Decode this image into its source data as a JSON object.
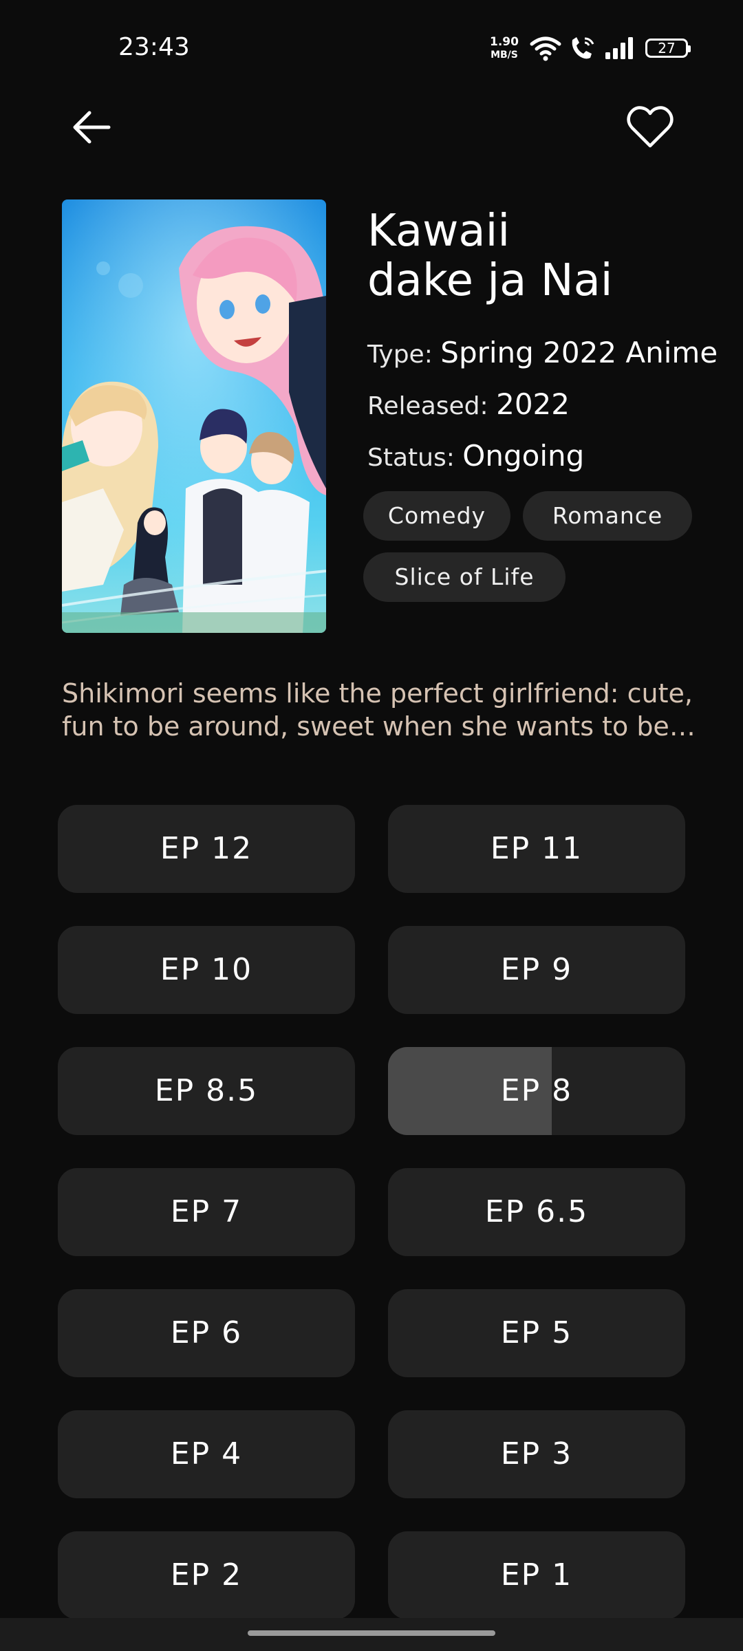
{
  "status_bar": {
    "time": "23:43",
    "net_speed_value": "1.90",
    "net_speed_unit": "MB/S",
    "battery": "27",
    "icons": [
      "wifi-icon",
      "wifi-call-icon",
      "signal-icon",
      "battery-icon"
    ]
  },
  "top_bar": {
    "back_icon": "arrow-left-icon",
    "favorite_icon": "heart-outline-icon"
  },
  "anime": {
    "title_line1": "Kawaii",
    "title_line2": "dake ja Nai",
    "type_label": "Type:",
    "type_value": "Spring 2022 Anime",
    "released_label": "Released:",
    "released_value": "2022",
    "status_label": "Status:",
    "status_value": "Ongoing",
    "genres": [
      "Comedy",
      "Romance",
      "Slice of Life"
    ],
    "description": "Shikimori seems like the perfect girlfriend: cute, fun to be around, sweet when she wants to be…"
  },
  "episodes": [
    {
      "label": "EP 12"
    },
    {
      "label": "EP 11"
    },
    {
      "label": "EP 10"
    },
    {
      "label": "EP 9"
    },
    {
      "label": "EP 8.5"
    },
    {
      "label": "EP 8",
      "progress": 0.55
    },
    {
      "label": "EP 7"
    },
    {
      "label": "EP 6.5"
    },
    {
      "label": "EP 6"
    },
    {
      "label": "EP 5"
    },
    {
      "label": "EP 4"
    },
    {
      "label": "EP 3"
    },
    {
      "label": "EP 2"
    },
    {
      "label": "EP 1"
    }
  ],
  "colors": {
    "background": "#0c0c0c",
    "card": "#222222",
    "progress": "#4a4a4a",
    "description": "#d6c3b3"
  }
}
